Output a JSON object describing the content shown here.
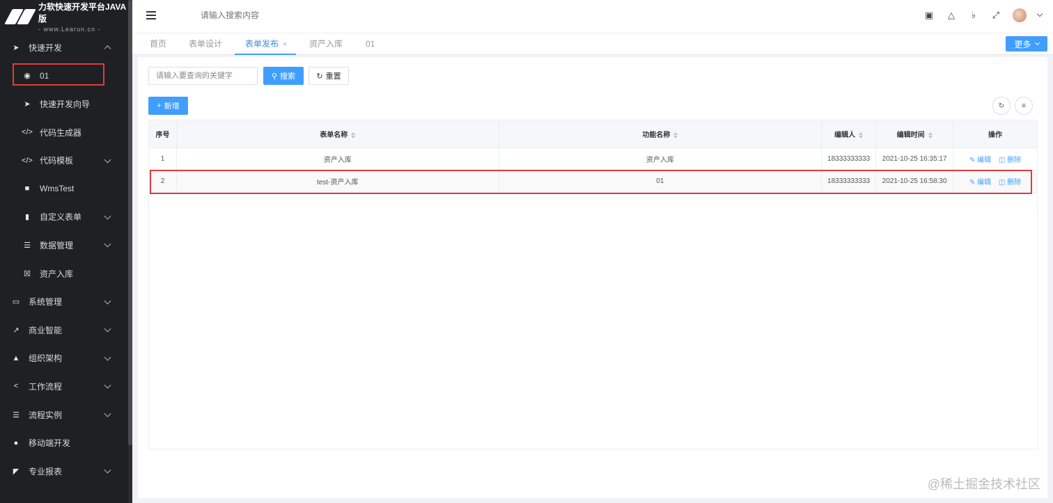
{
  "app": {
    "title": "力软快速开发平台JAVA版",
    "subtitle": "- www.Learun.cn -"
  },
  "sidebar": {
    "items": [
      {
        "label": "快速开发",
        "icon": "paper-plane-icon",
        "level": 1,
        "expanded": true
      },
      {
        "label": "01",
        "icon": "radio-icon",
        "level": 2,
        "selected": true
      },
      {
        "label": "快速开发向导",
        "icon": "telegram-icon",
        "level": 2
      },
      {
        "label": "代码生成器",
        "icon": "code-icon",
        "level": 2
      },
      {
        "label": "代码模板",
        "icon": "code-icon",
        "level": 2,
        "has_children": true
      },
      {
        "label": "WmsTest",
        "icon": "square-icon",
        "level": 2
      },
      {
        "label": "自定义表单",
        "icon": "file-icon",
        "level": 2,
        "has_children": true
      },
      {
        "label": "数据管理",
        "icon": "database-icon",
        "level": 2,
        "has_children": true
      },
      {
        "label": "资产入库",
        "icon": "close-box-icon",
        "level": 2
      },
      {
        "label": "系统管理",
        "icon": "monitor-icon",
        "level": 1,
        "has_children": true
      },
      {
        "label": "商业智能",
        "icon": "chart-line-icon",
        "level": 1,
        "has_children": true
      },
      {
        "label": "组织架构",
        "icon": "sitemap-icon",
        "level": 1,
        "has_children": true
      },
      {
        "label": "工作流程",
        "icon": "share-icon",
        "level": 1,
        "has_children": true
      },
      {
        "label": "流程实例",
        "icon": "list-icon",
        "level": 1,
        "has_children": true
      },
      {
        "label": "移动端开发",
        "icon": "android-icon",
        "level": 1
      },
      {
        "label": "专业报表",
        "icon": "area-chart-icon",
        "level": 1,
        "has_children": true
      }
    ]
  },
  "header": {
    "search_placeholder": "请输入搜索内容"
  },
  "tabs": [
    {
      "label": "首页",
      "active": false
    },
    {
      "label": "表单设计",
      "active": false
    },
    {
      "label": "表单发布",
      "active": true,
      "closable": true
    },
    {
      "label": "资产入库",
      "active": false
    },
    {
      "label": "01",
      "active": false
    }
  ],
  "tab_close_glyph": "×",
  "more_label": "更多",
  "toolbar": {
    "keyword_placeholder": "请输入要查询的关键字",
    "search_label": "搜索",
    "reset_label": "重置",
    "add_label": "新增"
  },
  "table": {
    "columns": [
      "序号",
      "表单名称",
      "功能名称",
      "编辑人",
      "编辑时间",
      "操作"
    ],
    "rows": [
      {
        "index": "1",
        "form_name": "资产入库",
        "function_name": "资产入库",
        "editor": "18333333333",
        "edit_time": "2021-10-25 16:35:17"
      },
      {
        "index": "2",
        "form_name": "test-资产入库",
        "function_name": "01",
        "editor": "18333333333",
        "edit_time": "2021-10-25 16:58:30"
      }
    ],
    "actions": {
      "edit": "编辑",
      "delete": "删除"
    }
  },
  "watermark": "@稀土掘金技术社区",
  "colors": {
    "primary": "#409eff",
    "sidebar_bg": "#1f2023",
    "highlight": "#e33b3b"
  }
}
